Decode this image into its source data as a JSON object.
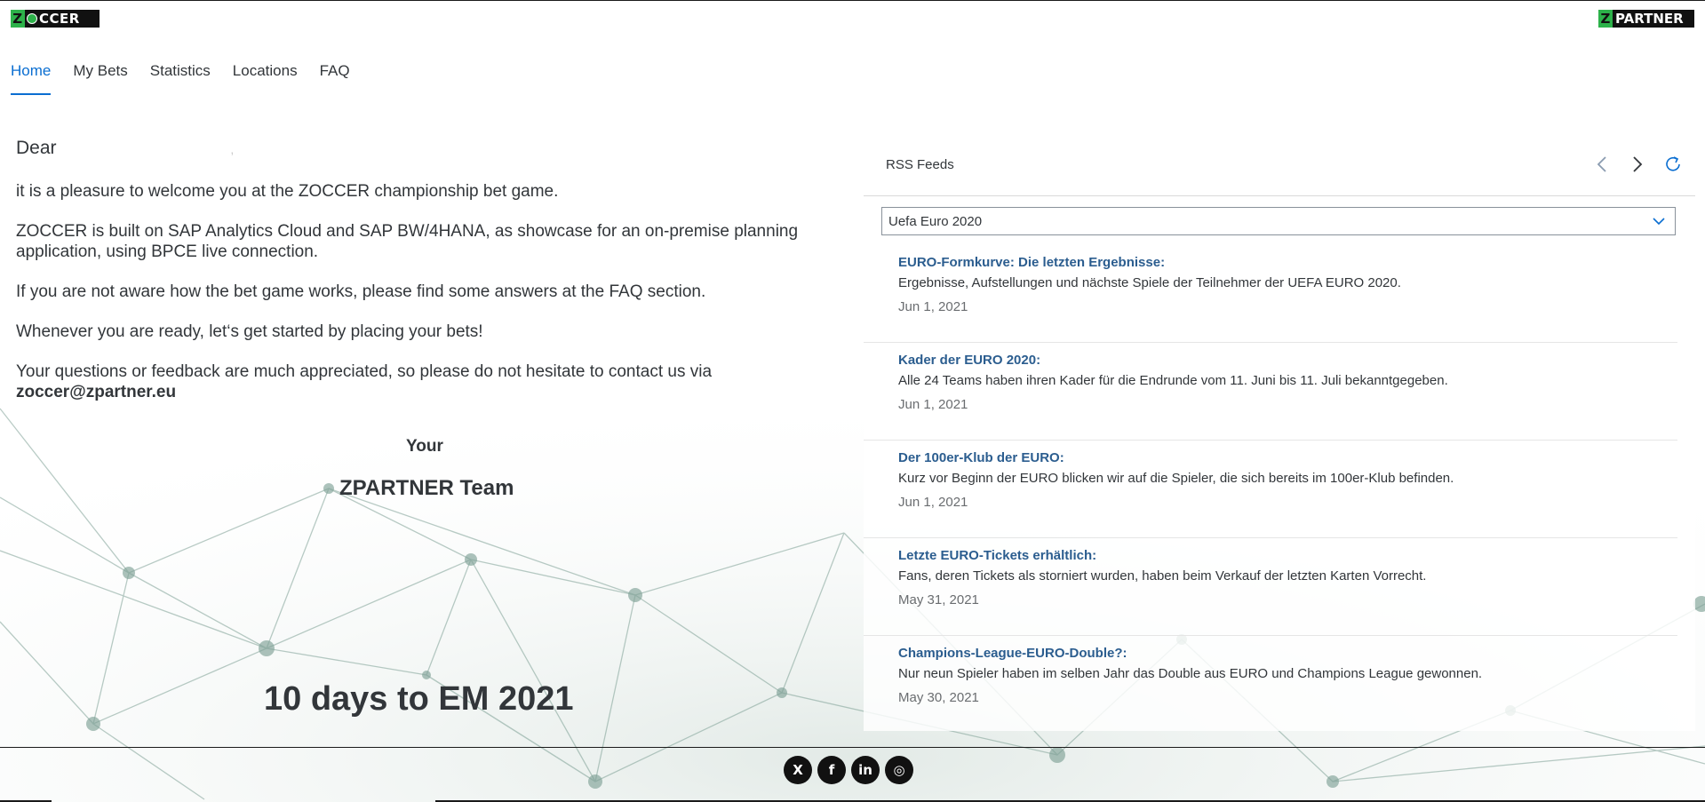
{
  "brand": {
    "left_logo_text": "ZOCCER",
    "right_logo_text": "ZPARTNER"
  },
  "nav": {
    "tabs": [
      {
        "label": "Home",
        "active": true
      },
      {
        "label": "My Bets",
        "active": false
      },
      {
        "label": "Statistics",
        "active": false
      },
      {
        "label": "Locations",
        "active": false
      },
      {
        "label": "FAQ",
        "active": false
      }
    ]
  },
  "welcome": {
    "greeting": "Dear",
    "greeting_suffix": ",",
    "p1": "it is a pleasure to welcome you at the ZOCCER championship bet game.",
    "p2": "ZOCCER is built on SAP Analytics Cloud and SAP BW/4HANA, as showcase for an on-premise planning application, using BPCE live connection.",
    "p3": "If you are not aware how the bet game works, please find some answers at the FAQ section.",
    "p4": "Whenever you are ready, let‘s get started by placing your bets!",
    "p5_text": "Your questions or feedback are much appreciated, so please do not hesitate to contact us via",
    "p5_email": "zoccer@zpartner.eu",
    "sign_line1": "Your",
    "sign_line2": "ZPARTNER Team",
    "countdown": "10 days to EM 2021"
  },
  "rss": {
    "title": "RSS Feeds",
    "selected_feed": "Uefa Euro 2020",
    "items": [
      {
        "title": "EURO-Formkurve: Die letzten Ergebnisse:",
        "description": "Ergebnisse, Aufstellungen und nächste Spiele der Teilnehmer der UEFA EURO 2020.",
        "date": "Jun 1, 2021"
      },
      {
        "title": "Kader der EURO 2020:",
        "description": "Alle 24 Teams haben ihren Kader für die Endrunde vom 11. Juni bis 11. Juli bekanntgegeben.",
        "date": "Jun 1, 2021"
      },
      {
        "title": "Der 100er-Klub der EURO:",
        "description": "Kurz vor Beginn der EURO blicken wir auf die Spieler, die sich bereits im 100er-Klub befinden.",
        "date": "Jun 1, 2021"
      },
      {
        "title": "Letzte EURO-Tickets erhältlich:",
        "description": "Fans, deren Tickets als storniert wurden, haben beim Verkauf der letzten Karten Vorrecht.",
        "date": "May 31, 2021"
      },
      {
        "title": "Champions-League-EURO-Double?:",
        "description": "Nur neun Spieler haben im selben Jahr das Double aus EURO und Champions League gewonnen.",
        "date": "May 30, 2021"
      }
    ]
  },
  "footer": {
    "social": [
      {
        "name": "xing-icon",
        "glyph": "X"
      },
      {
        "name": "facebook-icon",
        "glyph": "f"
      },
      {
        "name": "linkedin-icon",
        "glyph": "in"
      },
      {
        "name": "instagram-icon",
        "glyph": "◎"
      }
    ]
  },
  "colors": {
    "accent": "#0a6ed1",
    "link_title": "#2b5d8f",
    "brand_green": "#2db24a"
  }
}
